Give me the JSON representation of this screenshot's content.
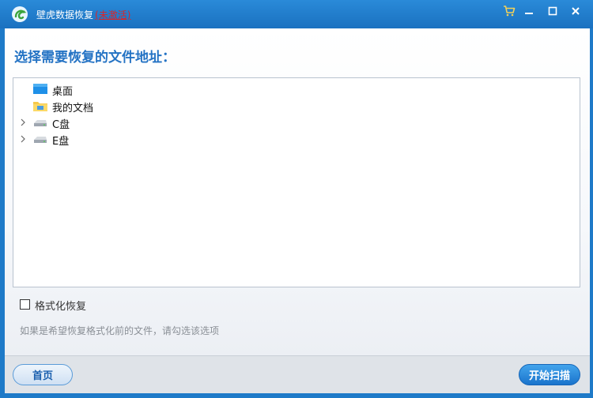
{
  "window": {
    "title": "壁虎数据恢复",
    "status": "(未激活)",
    "controls": [
      "cart-icon",
      "minimize-icon",
      "maximize-icon",
      "close-icon"
    ]
  },
  "main": {
    "heading": "选择需要恢复的文件地址："
  },
  "tree": {
    "items": [
      {
        "label": "桌面",
        "icon": "desktop-icon",
        "expandable": false
      },
      {
        "label": "我的文档",
        "icon": "documents-folder-icon",
        "expandable": false
      },
      {
        "label": "C盘",
        "icon": "drive-icon",
        "expandable": true
      },
      {
        "label": "E盘",
        "icon": "drive-icon",
        "expandable": true
      }
    ]
  },
  "options": {
    "format_recovery_label": "格式化恢复",
    "format_recovery_checked": false,
    "hint": "如果是希望恢复格式化前的文件，请勾选该选项"
  },
  "footer": {
    "home_label": "首页",
    "scan_label": "开始扫描"
  },
  "colors": {
    "titlebar": "#1a71c0",
    "accent": "#2473c4",
    "status": "#d9262a"
  }
}
